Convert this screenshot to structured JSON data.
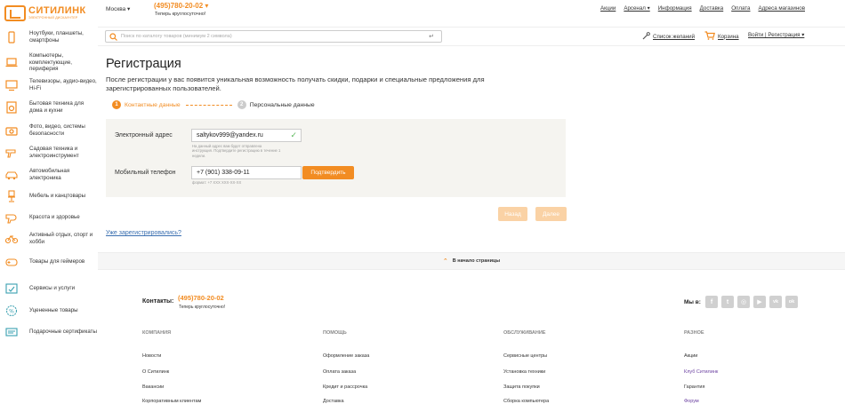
{
  "logo": {
    "name": "СИТИЛИНК",
    "sub": "ЭЛЕКТРОННЫЙ ДИСКАУНТЕР"
  },
  "sidebar": {
    "items": [
      {
        "label": "Ноутбуки, планшеты, смартфоны",
        "icon": "phone-icon"
      },
      {
        "label": "Компьютеры, комплектующие, периферия",
        "icon": "laptop-icon"
      },
      {
        "label": "Телевизоры, аудио-видео, Hi-Fi",
        "icon": "tv-icon"
      },
      {
        "label": "Бытовая техника для дома и кухни",
        "icon": "washer-icon"
      },
      {
        "label": "Фото, видео, системы безопасности",
        "icon": "camera-icon"
      },
      {
        "label": "Садовая техника и электроинструмент",
        "icon": "drill-icon"
      },
      {
        "label": "Автомобильная электроника",
        "icon": "car-icon"
      },
      {
        "label": "Мебель и канцтовары",
        "icon": "chair-icon"
      },
      {
        "label": "Красота и здоровье",
        "icon": "hairdryer-icon"
      },
      {
        "label": "Активный отдых, спорт и хобби",
        "icon": "bicycle-icon"
      },
      {
        "label": "Товары для геймеров",
        "icon": "gamepad-icon"
      },
      {
        "label": "Сервисы и услуги",
        "icon": "service-icon"
      },
      {
        "label": "Уцененные товары",
        "icon": "discount-icon"
      },
      {
        "label": "Подарочные сертификаты",
        "icon": "gift-card-icon"
      }
    ]
  },
  "header": {
    "city": "Москва ▾",
    "phone": "(495)780-20-02 ▾",
    "phone_sub": "Теперь круглосуточно!",
    "nav": [
      "Акции",
      "Арсенал ▾",
      "Информация",
      "Доставка",
      "Оплата",
      "Адреса магазинов"
    ]
  },
  "search": {
    "placeholder": "Поиск по каталогу товаров (минимум 2 символа)",
    "enter_glyph": "↵"
  },
  "actions": {
    "wishlist": "Список желаний",
    "cart": "Корзина",
    "login": "Войти | Регистрация ▾"
  },
  "page": {
    "title": "Регистрация",
    "description": "После регистрации у вас появится уникальная возможность получать скидки, подарки и специальные предложения для зарегистрированных пользователей."
  },
  "steps": [
    {
      "num": "1",
      "label": "Контактные данные"
    },
    {
      "num": "2",
      "label": "Персональные данные"
    }
  ],
  "form": {
    "email_label": "Электронный адрес",
    "email_value": "saltykov999@yandex.ru",
    "email_hint": "На данный адрес вам будет отправлена инструкция. Подтвердите регистрацию в течение 1 недели.",
    "phone_label": "Мобильный телефон",
    "phone_value": "+7 (901) 338-09-11",
    "phone_hint": "формат: +7 XXX XXX-XX-XX",
    "confirm": "Подтвердить",
    "check": "✓"
  },
  "buttons": {
    "back": "Назад",
    "next": "Далее"
  },
  "already_link": "Уже зарегистрировались?",
  "to_top": "В начало страницы",
  "footer": {
    "contacts_label": "Контакты:",
    "phone": "(495)780-20-02",
    "phone_sub": "Теперь круглосуточно!",
    "social_label": "Мы в:",
    "socials": [
      "f",
      "t",
      "◎",
      "▶",
      "vk",
      "ok"
    ],
    "columns": [
      {
        "title": "КОМПАНИЯ",
        "items": [
          "Новости",
          "О Ситилинк",
          "Вакансии",
          "Корпоративным клиентам"
        ]
      },
      {
        "title": "ПОМОЩЬ",
        "items": [
          "Оформление заказа",
          "Оплата заказа",
          "Кредит и рассрочка",
          "Доставка"
        ]
      },
      {
        "title": "ОБСЛУЖИВАНИЕ",
        "items": [
          "Сервисные центры",
          "Установка техники",
          "Защита покупки",
          "Сборка компьютера"
        ]
      },
      {
        "title": "РАЗНОЕ",
        "items": [
          "Акции",
          "Клуб Ситилинк",
          "Гарантия",
          "Форум"
        ]
      }
    ]
  },
  "colors": {
    "accent": "#f28c22",
    "link": "#3a6fb0"
  }
}
